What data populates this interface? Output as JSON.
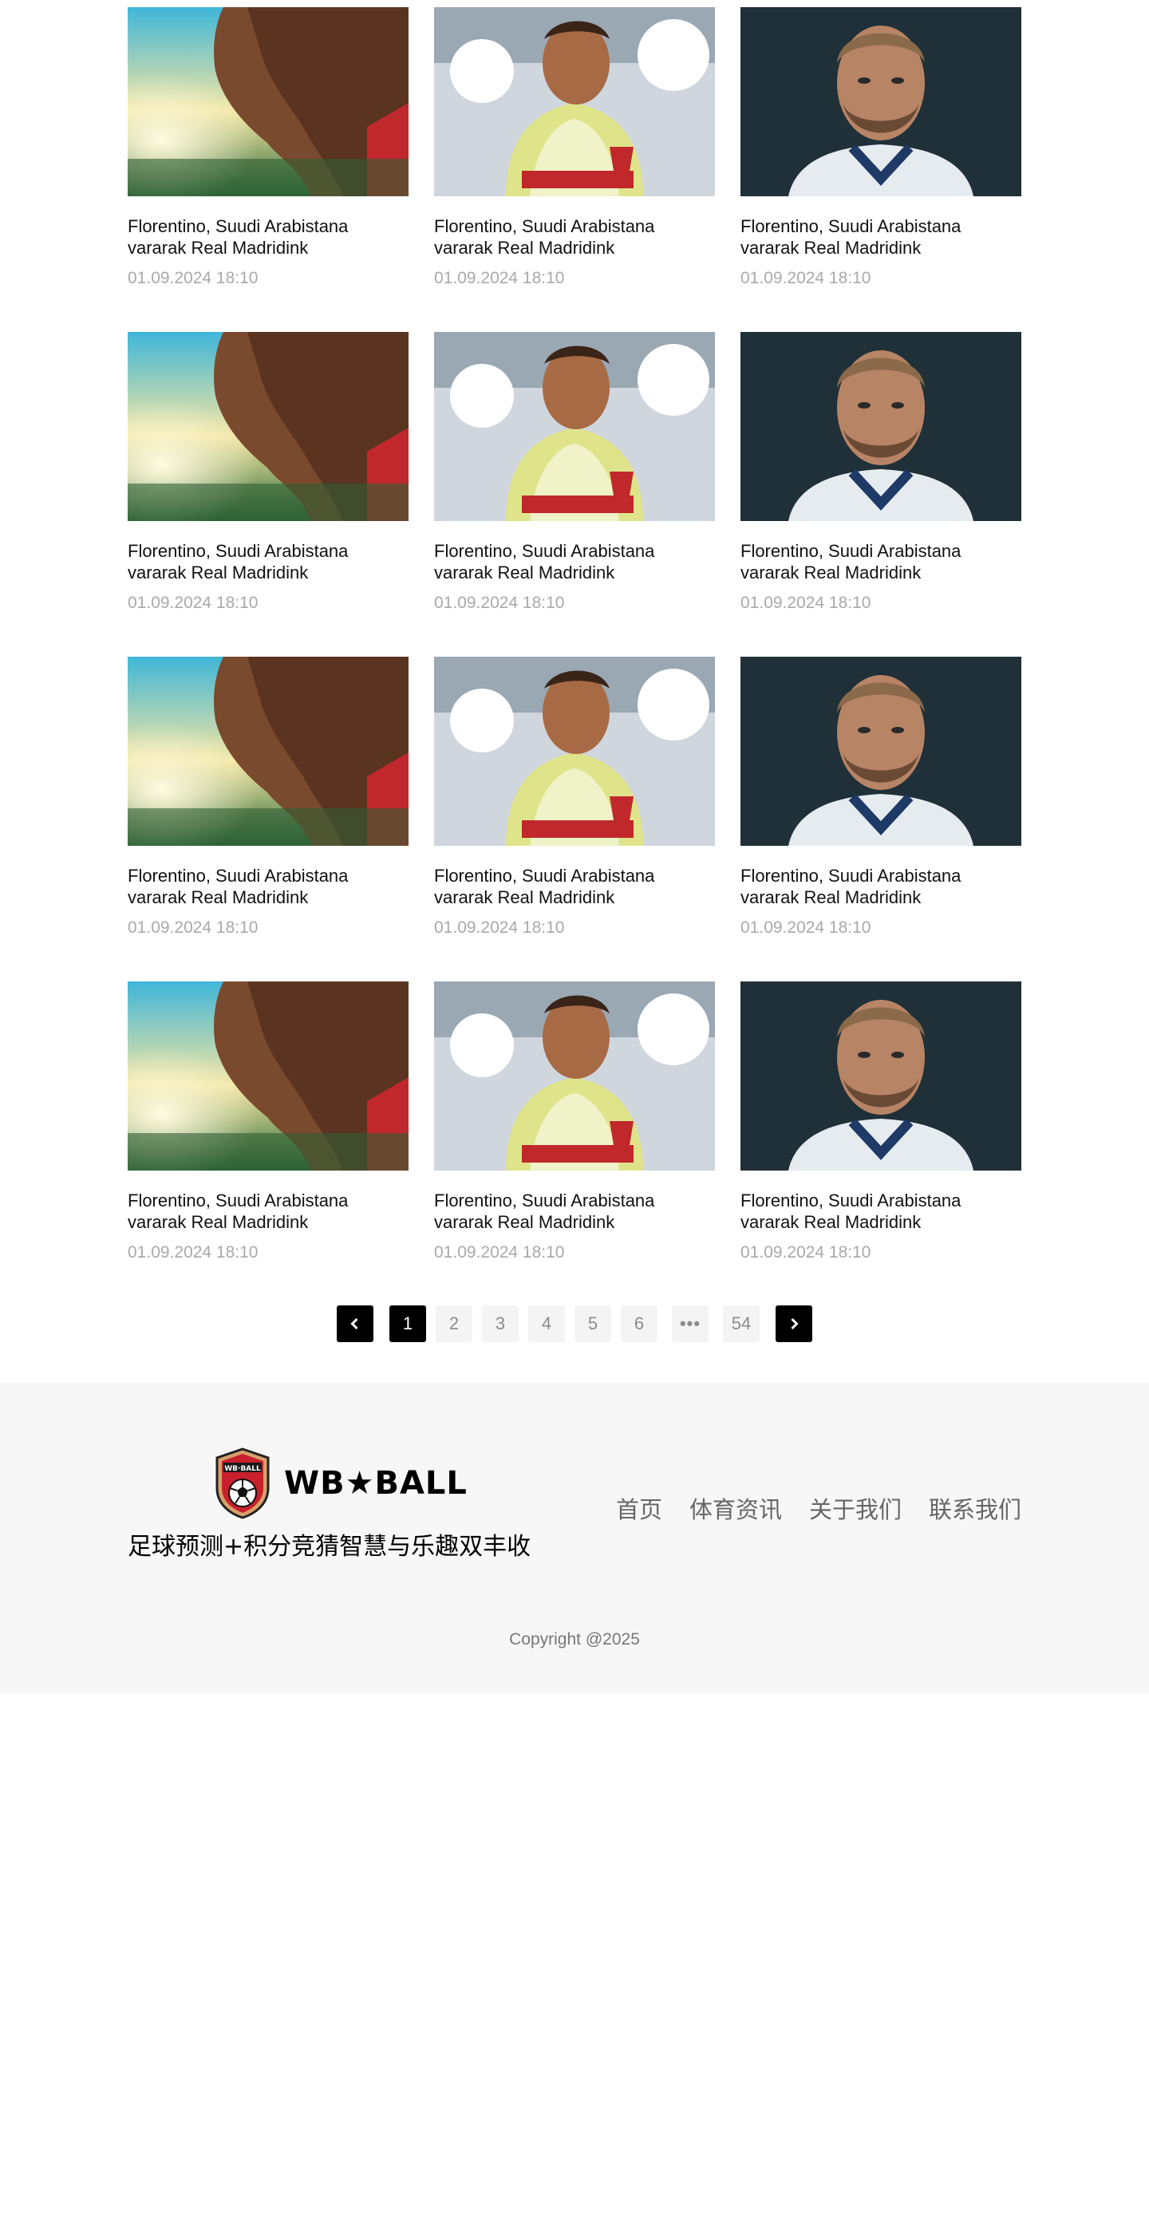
{
  "articles": [
    {
      "image": "player-sunset-photo",
      "title": "Florentino, Suudi Arabistana vararak Real Madridink",
      "date": "01.09.2024 18:10"
    },
    {
      "image": "player-splash-photo",
      "title": "Florentino, Suudi Arabistana vararak Real Madridink",
      "date": "01.09.2024 18:10"
    },
    {
      "image": "player-portrait-photo",
      "title": "Florentino, Suudi Arabistana vararak Real Madridink",
      "date": "01.09.2024 18:10"
    },
    {
      "image": "player-sunset-photo",
      "title": "Florentino, Suudi Arabistana vararak Real Madridink",
      "date": "01.09.2024 18:10"
    },
    {
      "image": "player-splash-photo",
      "title": "Florentino, Suudi Arabistana vararak Real Madridink",
      "date": "01.09.2024 18:10"
    },
    {
      "image": "player-portrait-photo",
      "title": "Florentino, Suudi Arabistana vararak Real Madridink",
      "date": "01.09.2024 18:10"
    },
    {
      "image": "player-sunset-photo",
      "title": "Florentino, Suudi Arabistana vararak Real Madridink",
      "date": "01.09.2024 18:10"
    },
    {
      "image": "player-splash-photo",
      "title": "Florentino, Suudi Arabistana vararak Real Madridink",
      "date": "01.09.2024 18:10"
    },
    {
      "image": "player-portrait-photo",
      "title": "Florentino, Suudi Arabistana vararak Real Madridink",
      "date": "01.09.2024 18:10"
    },
    {
      "image": "player-sunset-photo",
      "title": "Florentino, Suudi Arabistana vararak Real Madridink",
      "date": "01.09.2024 18:10"
    },
    {
      "image": "player-splash-photo",
      "title": "Florentino, Suudi Arabistana vararak Real Madridink",
      "date": "01.09.2024 18:10"
    },
    {
      "image": "player-portrait-photo",
      "title": "Florentino, Suudi Arabistana vararak Real Madridink",
      "date": "01.09.2024 18:10"
    }
  ],
  "pagination": {
    "prev_icon": "chevron-left-icon",
    "next_icon": "chevron-right-icon",
    "pages": [
      "1",
      "2",
      "3",
      "4",
      "5",
      "6"
    ],
    "current": "1",
    "ellipsis": "•••",
    "last": "54"
  },
  "footer": {
    "logo_text": "WB★BALL",
    "slogan": "足球预测+积分竞猜智慧与乐趣双丰收",
    "nav": [
      "首页",
      "体育资讯",
      "关于我们",
      "联系我们"
    ],
    "copyright": "Copyright @2025"
  },
  "colors": {
    "footer_bg": "#f7f7f7",
    "active_page_bg": "#000000",
    "page_bg": "#f4f4f4",
    "date_text": "#a9a9a9"
  }
}
